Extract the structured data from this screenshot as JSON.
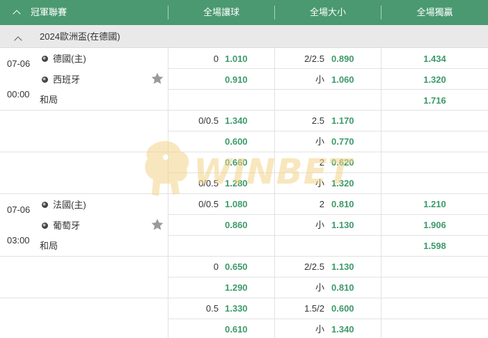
{
  "header": {
    "collapse_icon": "chevron-up-icon",
    "league_label": "冠軍聯賽",
    "col_handicap": "全場讓球",
    "col_overunder": "全場大小",
    "col_moneyline": "全場獨贏"
  },
  "league": {
    "collapse_icon": "chevron-up-icon",
    "title": "2024歐洲盃(在德國)"
  },
  "matches": [
    {
      "date": "07-06",
      "time": "00:00",
      "home": "德國(主)",
      "away": "西班牙",
      "draw": "和局",
      "favorite_icon": "star-icon",
      "markets": [
        {
          "handicap": {
            "home_line": "0",
            "home_odds": "1.010",
            "away_line": "",
            "away_odds": "0.910"
          },
          "overunder": {
            "over_line": "2/2.5",
            "over_odds": "0.890",
            "under_label": "小",
            "under_odds": "1.060"
          },
          "moneyline": {
            "home": "1.434",
            "away": "1.320",
            "draw": "1.716"
          }
        },
        {
          "handicap": {
            "home_line": "0/0.5",
            "home_odds": "1.340",
            "away_line": "",
            "away_odds": "0.600"
          },
          "overunder": {
            "over_line": "2.5",
            "over_odds": "1.170",
            "under_label": "小",
            "under_odds": "0.770"
          }
        },
        {
          "handicap": {
            "home_line": "",
            "home_odds": "0.660",
            "away_line": "0/0.5",
            "away_odds": "1.280"
          },
          "overunder": {
            "over_line": "2",
            "over_odds": "0.620",
            "under_label": "小",
            "under_odds": "1.320"
          }
        }
      ]
    },
    {
      "date": "07-06",
      "time": "03:00",
      "home": "法國(主)",
      "away": "葡萄牙",
      "draw": "和局",
      "favorite_icon": "star-icon",
      "markets": [
        {
          "handicap": {
            "home_line": "0/0.5",
            "home_odds": "1.080",
            "away_line": "",
            "away_odds": "0.860"
          },
          "overunder": {
            "over_line": "2",
            "over_odds": "0.810",
            "under_label": "小",
            "under_odds": "1.130"
          },
          "moneyline": {
            "home": "1.210",
            "away": "1.906",
            "draw": "1.598"
          }
        },
        {
          "handicap": {
            "home_line": "0",
            "home_odds": "0.650",
            "away_line": "",
            "away_odds": "1.290"
          },
          "overunder": {
            "over_line": "2/2.5",
            "over_odds": "1.130",
            "under_label": "小",
            "under_odds": "0.810"
          }
        },
        {
          "handicap": {
            "home_line": "0.5",
            "home_odds": "1.330",
            "away_line": "",
            "away_odds": "0.610"
          },
          "overunder": {
            "over_line": "1.5/2",
            "over_odds": "0.600",
            "under_label": "小",
            "under_odds": "1.340"
          }
        }
      ]
    }
  ],
  "watermark": {
    "text": "WINBET"
  },
  "colors": {
    "header_bg": "#4a9970",
    "odds": "#3d9a6a",
    "league_bg": "#e9e9e9"
  }
}
